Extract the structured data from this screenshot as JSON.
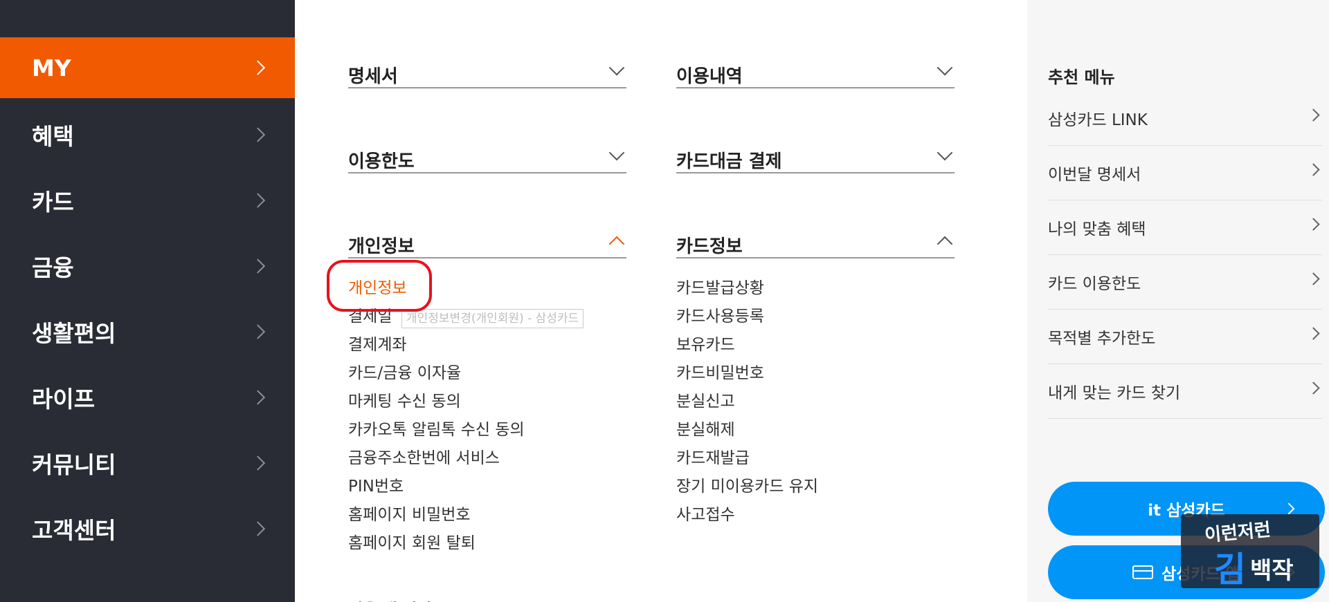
{
  "sidebar": {
    "items": [
      {
        "label": "MY",
        "active": true
      },
      {
        "label": "혜택"
      },
      {
        "label": "카드"
      },
      {
        "label": "금융"
      },
      {
        "label": "생활편의"
      },
      {
        "label": "라이프"
      },
      {
        "label": "커뮤니티"
      },
      {
        "label": "고객센터"
      }
    ]
  },
  "main": {
    "sections": {
      "statement": {
        "label": "명세서",
        "state": "collapsed"
      },
      "usage": {
        "label": "이용내역",
        "state": "collapsed"
      },
      "limit": {
        "label": "이용한도",
        "state": "collapsed"
      },
      "payment": {
        "label": "카드대금 결제",
        "state": "collapsed"
      },
      "personal": {
        "label": "개인정보",
        "state": "expanded",
        "items": [
          "개인정보",
          "결제일",
          "결제계좌",
          "카드/금융 이자율",
          "마케팅 수신 동의",
          "카카오톡 알림톡 수신 동의",
          "금융주소한번에 서비스",
          "PIN번호",
          "홈페이지 비밀번호",
          "홈페이지 회원 탈퇴"
        ]
      },
      "cardinfo": {
        "label": "카드정보",
        "state": "expanded",
        "items": [
          "카드발급상황",
          "카드사용등록",
          "보유카드",
          "카드비밀번호",
          "분실신고",
          "분실해제",
          "카드재발급",
          "장기 미이용카드 유지",
          "사고접수"
        ]
      }
    },
    "tooltip": "개인정보변경(개인회원) - 삼성카드",
    "next_section_partial": "이용 내 서비스"
  },
  "right_panel": {
    "title": "추천 메뉴",
    "items": [
      "삼성카드 LINK",
      "이번달 명세서",
      "나의 맞춤 혜택",
      "카드 이용한도",
      "목적별 추가한도",
      "내게 맞는 카드 찾기"
    ],
    "buttons": {
      "it_card": "it 삼성카드",
      "app": "삼성카드 앱"
    }
  },
  "watermark": {
    "line1": "이런저런",
    "line2": "김",
    "line3": "백작"
  },
  "colors": {
    "sidebar_bg": "#2a2c35",
    "accent_orange": "#f15a00",
    "button_blue": "#0095f6",
    "annotation_red": "#e8121a"
  }
}
